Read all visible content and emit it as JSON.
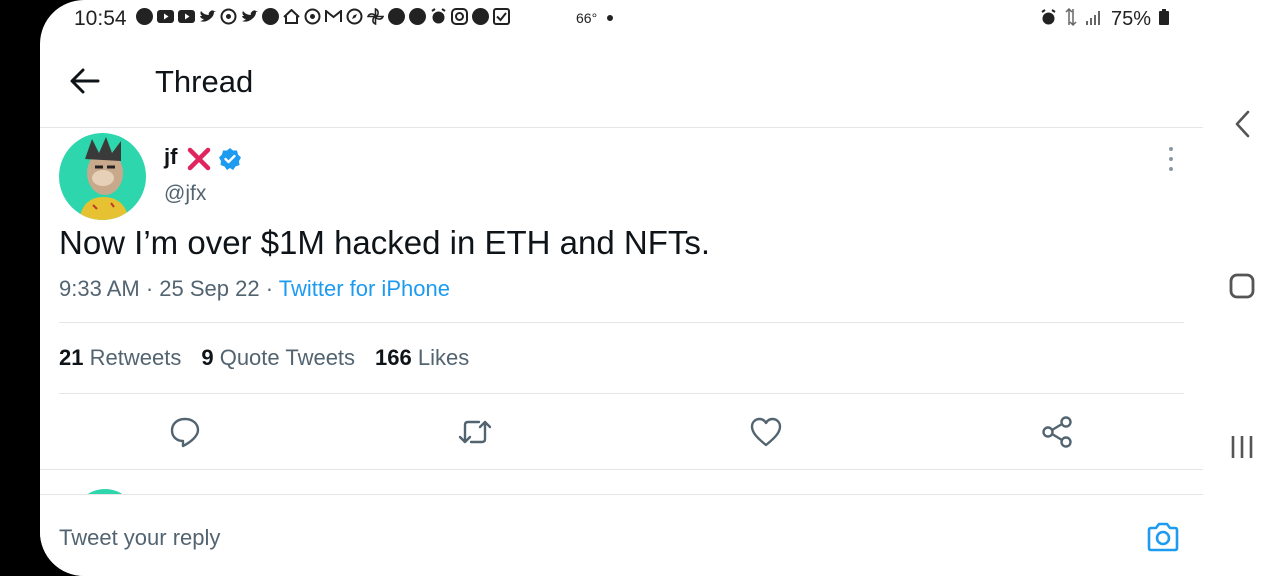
{
  "status_bar": {
    "time": "10:54",
    "temperature": "66°",
    "battery": "75%"
  },
  "header": {
    "title": "Thread"
  },
  "tweet": {
    "display_name": "jf",
    "handle": "@jfx",
    "text": "Now I’m over $1M hacked in ETH and NFTs.",
    "time": "9:33 AM",
    "date": "25 Sep 22",
    "source": "Twitter for iPhone",
    "stats": {
      "retweets_count": "21",
      "retweets_label": "Retweets",
      "quotes_count": "9",
      "quotes_label": "Quote Tweets",
      "likes_count": "166",
      "likes_label": "Likes"
    }
  },
  "reply": {
    "placeholder": "Tweet your reply"
  },
  "colors": {
    "accent": "#1d9bf0",
    "avatar_bg": "#2ed6ad",
    "x_mark": "#e0245e"
  }
}
